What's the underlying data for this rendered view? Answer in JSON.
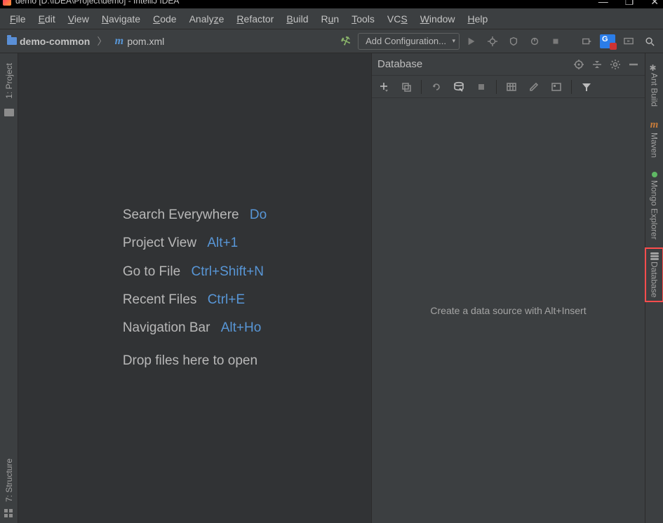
{
  "titlebar": {
    "title": "demo [D:\\IDEA\\Project\\demo] - IntelliJ IDEA",
    "min": "—",
    "max": "❐",
    "close": "✕"
  },
  "menu": {
    "file": "File",
    "edit": "Edit",
    "view": "View",
    "navigate": "Navigate",
    "code": "Code",
    "analyze": "Analyze",
    "refactor": "Refactor",
    "build": "Build",
    "run": "Run",
    "tools": "Tools",
    "vcs": "VCS",
    "window": "Window",
    "help": "Help"
  },
  "breadcrumbs": {
    "item0": "demo-common",
    "item1": "pom.xml"
  },
  "toolbar": {
    "add_configuration": "Add Configuration..."
  },
  "left_gutter": {
    "project": "1: Project",
    "structure": "7: Structure"
  },
  "editor_tips": {
    "search_label": "Search Everywhere",
    "search_key": "Do",
    "project_label": "Project View",
    "project_key": "Alt+1",
    "gotofile_label": "Go to File",
    "gotofile_key": "Ctrl+Shift+N",
    "recent_label": "Recent Files",
    "recent_key": "Ctrl+E",
    "navbar_label": "Navigation Bar",
    "navbar_key": "Alt+Ho",
    "drop": "Drop files here to open"
  },
  "db_panel": {
    "title": "Database",
    "hint": "Create a data source with Alt+Insert"
  },
  "right_gutter": {
    "ant": "Ant Build",
    "maven": "Maven",
    "mongo": "Mongo Explorer",
    "database": "Database"
  }
}
